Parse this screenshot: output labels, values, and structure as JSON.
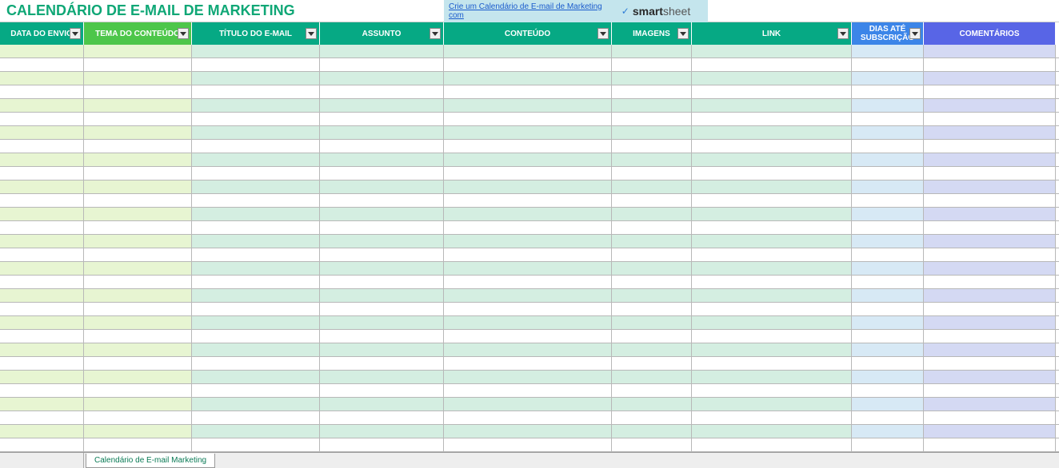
{
  "title": "CALENDÁRIO DE E-MAIL DE MARKETING",
  "link_text": "Crie um Calendário de E-mail de Marketing com",
  "logo": {
    "smart": "smart",
    "sheet": "sheet"
  },
  "headers": {
    "data_envio": "DATA DO ENVIO",
    "tema": "TEMA DO CONTEÚDO",
    "titulo": "TÍTULO DO E-MAIL",
    "assunto": "ASSUNTO",
    "conteudo": "CONTEÚDO",
    "imagens": "IMAGENS",
    "link": "LINK",
    "dias": "DIAS ATÉ SUBSCRIÇÃO",
    "comentarios": "COMENTÁRIOS"
  },
  "row_count": 30,
  "sheet_tab": "Calendário de E-mail Marketing"
}
